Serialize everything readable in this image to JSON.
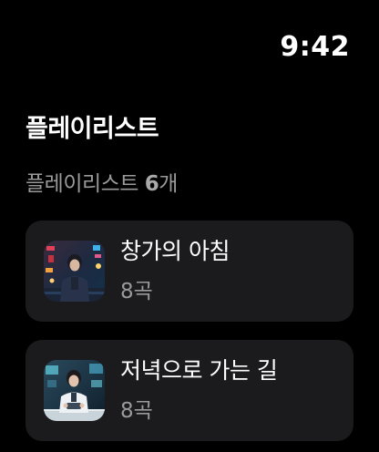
{
  "status_bar": {
    "time": "9:42"
  },
  "header": {
    "title": "플레이리스트",
    "count_prefix": "플레이리스트 ",
    "count_value": "6",
    "count_suffix": "개"
  },
  "playlists": [
    {
      "title": "창가의 아침",
      "track_count": "8곡",
      "artwork_icon": "city-night-portrait-artwork"
    },
    {
      "title": "저녁으로 가는 길",
      "track_count": "8곡",
      "artwork_icon": "lab-portrait-artwork"
    }
  ],
  "colors": {
    "background": "#000000",
    "card_background": "#1b1b1d",
    "primary_text": "#ffffff",
    "secondary_text": "#9a9a9a"
  }
}
